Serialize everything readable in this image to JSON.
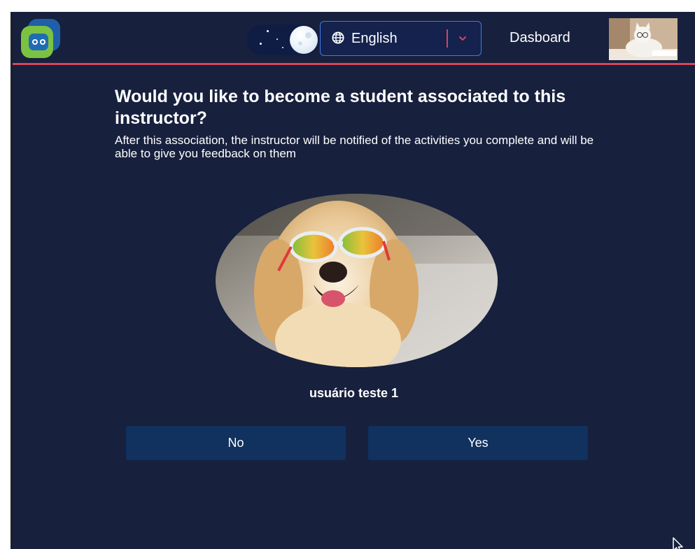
{
  "navbar": {
    "logo_icon": "app-logo-icon",
    "theme_icon": "moon-icon",
    "language": {
      "selected": "English",
      "icon": "globe-icon",
      "dropdown_icon": "chevron-down-icon"
    },
    "dashboard_label": "Dasboard",
    "avatar_icon": "user-avatar"
  },
  "association": {
    "question": "Would you like to become a student associated to this instructor?",
    "description": "After this association, the instructor will be notified of the activities you complete and will be able to give you feedback on them"
  },
  "instructor": {
    "name": "usuário teste 1"
  },
  "actions": {
    "no_label": "No",
    "yes_label": "Yes"
  },
  "colors": {
    "background": "#17203d",
    "accent": "#d9435a",
    "button": "#11315f",
    "select_border": "#3f7be2"
  }
}
